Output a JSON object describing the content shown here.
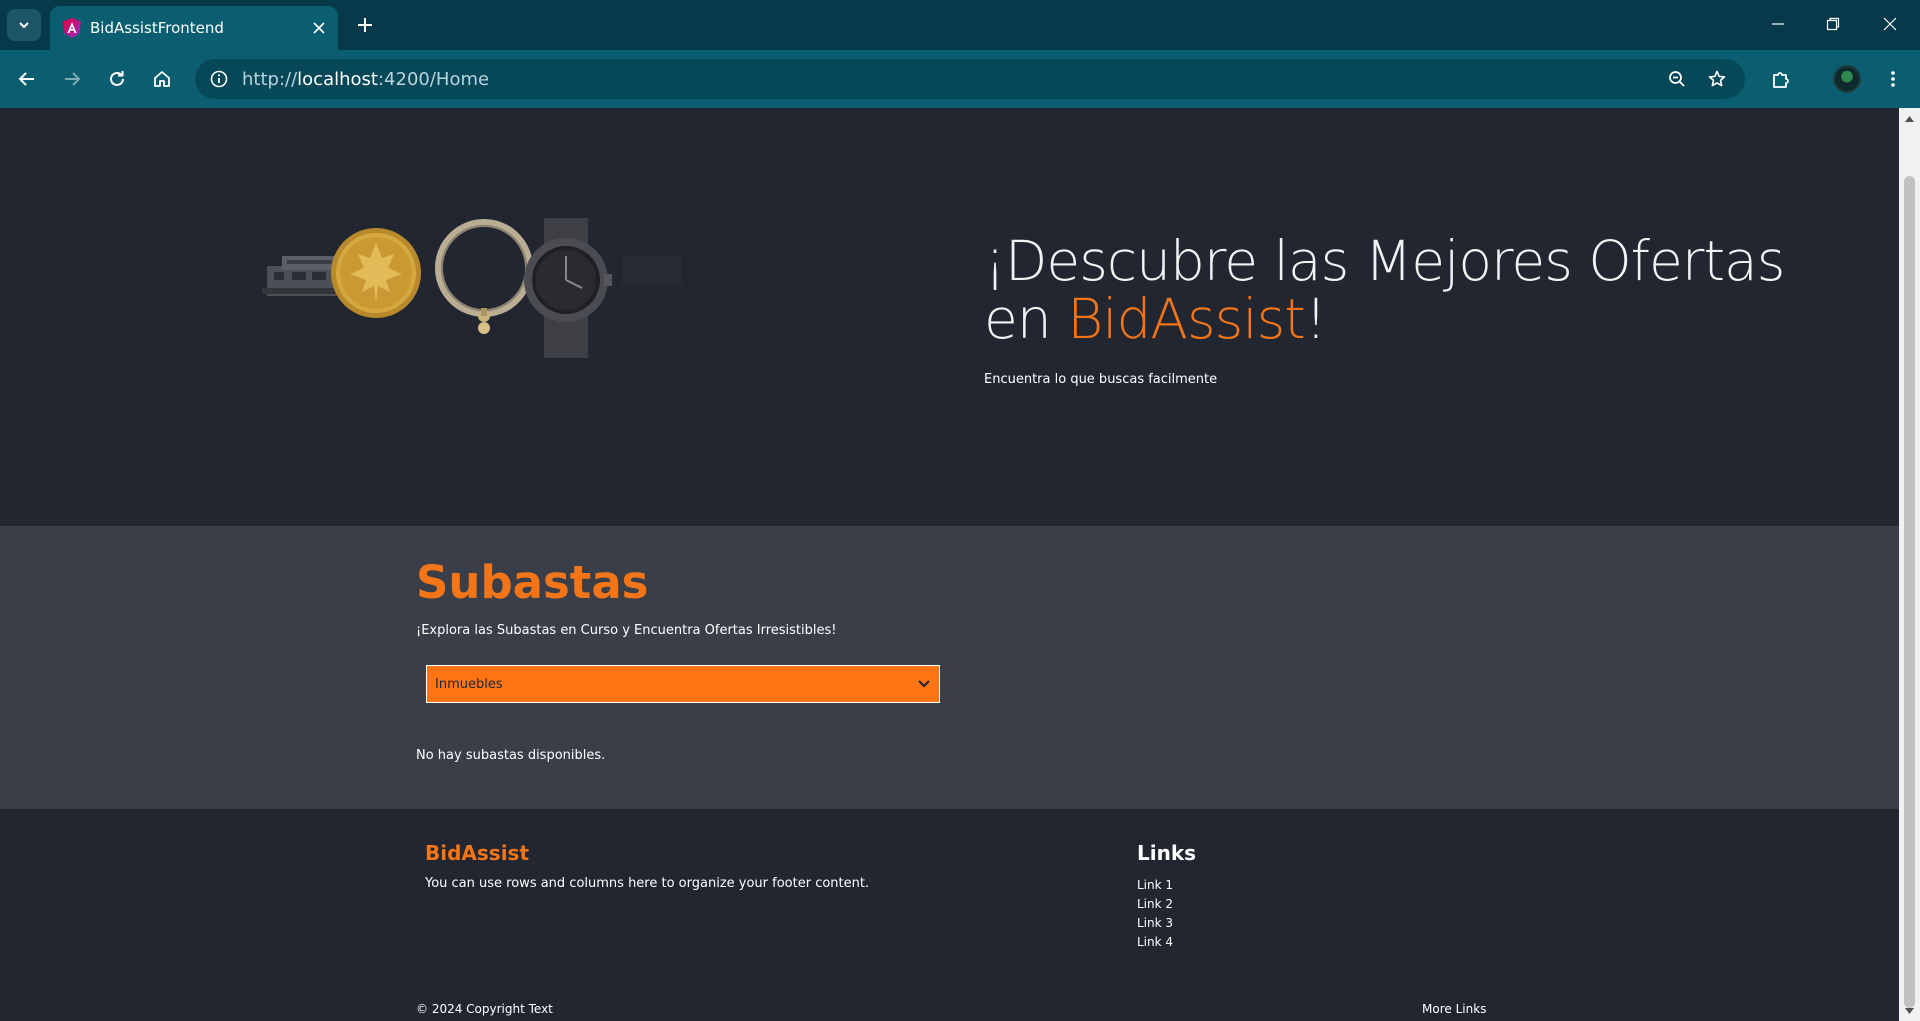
{
  "browser": {
    "tab_title": "BidAssistFrontend",
    "url_scheme": "http://",
    "url_host": "localhost",
    "url_path": ":4200/Home"
  },
  "hero": {
    "title_prefix": "¡Descubre las Mejores Ofertas en ",
    "title_brand": "BidAssist",
    "title_suffix": "!",
    "subtitle": "Encuentra lo que buscas facilmente",
    "images": [
      "house",
      "gold-coin",
      "bracelet",
      "watch"
    ]
  },
  "auctions": {
    "title": "Subastas",
    "subtitle": "¡Explora las Subastas en Curso y Encuentra Ofertas Irresistibles!",
    "category_select": {
      "selected": "Inmuebles"
    },
    "empty_message": "No hay subastas disponibles."
  },
  "footer": {
    "brand": "BidAssist",
    "description": "You can use rows and columns here to organize your footer content.",
    "links_title": "Links",
    "links": [
      "Link 1",
      "Link 2",
      "Link 3",
      "Link 4"
    ],
    "copyright": "© 2024 Copyright Text",
    "more_links": "More Links"
  },
  "colors": {
    "accent": "#f47517",
    "hero_bg": "#222631",
    "section_bg": "#3a3e48",
    "chrome_tab": "#0b5e70"
  }
}
